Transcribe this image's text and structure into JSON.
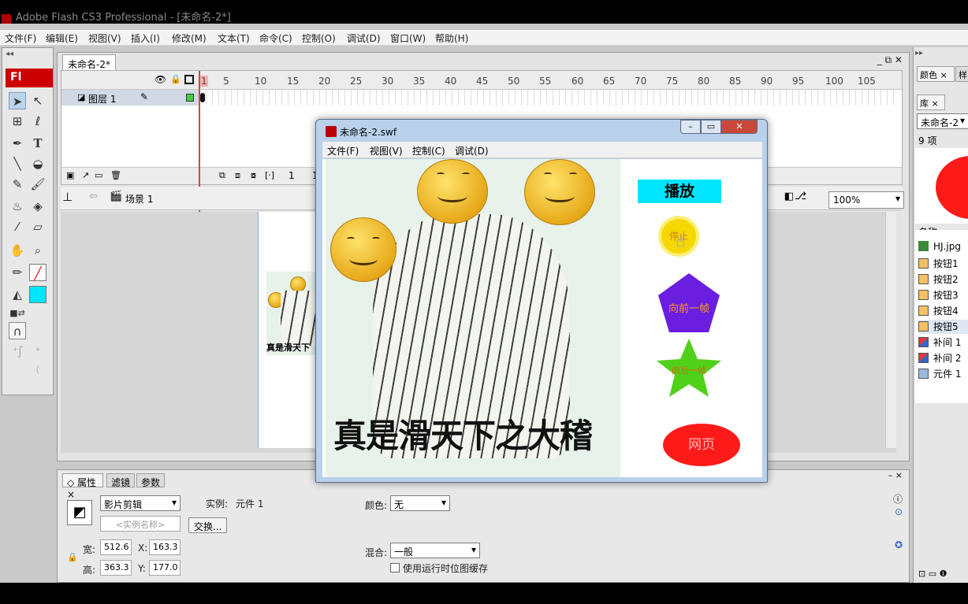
{
  "app": {
    "title": "Adobe Flash CS3 Professional - [未命名-2*]"
  },
  "menu": [
    "文件(F)",
    "编辑(E)",
    "视图(V)",
    "插入(I)",
    "修改(M)",
    "文本(T)",
    "命令(C)",
    "控制(O)",
    "调试(D)",
    "窗口(W)",
    "帮助(H)"
  ],
  "tools": {
    "logo": "Fl"
  },
  "document": {
    "tab": "未命名-2*",
    "controls": "_ ⧉ ✕"
  },
  "timeline": {
    "frame_numbers": [
      "1",
      "5",
      "10",
      "15",
      "20",
      "25",
      "30",
      "35",
      "40",
      "45",
      "50",
      "55",
      "60",
      "65",
      "70",
      "75",
      "80",
      "85",
      "90",
      "95",
      "100",
      "105"
    ],
    "layer_name": "图层 1",
    "current_frame": "1",
    "fps_partial": "1"
  },
  "editbar": {
    "scene": "场景 1",
    "zoom": "100%"
  },
  "stage": {
    "caption_partial": "真是滑天下"
  },
  "swf_window": {
    "title": "未命名-2.swf",
    "menu": [
      "文件(F)",
      "视图(V)",
      "控制(C)",
      "调试(D)"
    ],
    "caption": "真是滑天下之大稽",
    "play_button": "播放",
    "stop_button": "停止",
    "prev_button": "向前一帧",
    "next_button": "向后一帧",
    "web_button": "网页",
    "colors": {
      "play": "#00e5ff",
      "stop": "#f5d800",
      "prev": "#6a1ee0",
      "next": "#4fd11a",
      "web": "#ff1a1a"
    }
  },
  "properties": {
    "tabs": [
      "属性",
      "滤镜",
      "参数"
    ],
    "symbol_type": "影片剪辑",
    "instance_label": "实例:",
    "instance_value": "元件 1",
    "instance_name_placeholder": "<实例名称>",
    "swap_button": "交换...",
    "width_label": "宽:",
    "width_value": "512.6",
    "height_label": "高:",
    "height_value": "363.3",
    "x_label": "X:",
    "x_value": "163.3",
    "y_label": "Y:",
    "y_value": "177.0",
    "color_label": "颜色:",
    "color_value": "无",
    "blend_label": "混合:",
    "blend_value": "一般",
    "cache_label": "使用运行时位图缓存"
  },
  "right_panel": {
    "tabs": [
      "颜色",
      "样"
    ],
    "library_tab": "库",
    "library_doc": "未命名-2",
    "item_count": "9 项",
    "name_header": "名称",
    "items": [
      {
        "label": "HJ.jpg",
        "icon": "bitmap-icon"
      },
      {
        "label": "按钮1",
        "icon": "button-icon"
      },
      {
        "label": "按钮2",
        "icon": "button-icon"
      },
      {
        "label": "按钮3",
        "icon": "button-icon"
      },
      {
        "label": "按钮4",
        "icon": "button-icon"
      },
      {
        "label": "按钮5",
        "icon": "button-icon"
      },
      {
        "label": "补间 1",
        "icon": "graphic-icon"
      },
      {
        "label": "补间 2",
        "icon": "graphic-icon"
      },
      {
        "label": "元件 1",
        "icon": "movieclip-icon"
      }
    ]
  }
}
